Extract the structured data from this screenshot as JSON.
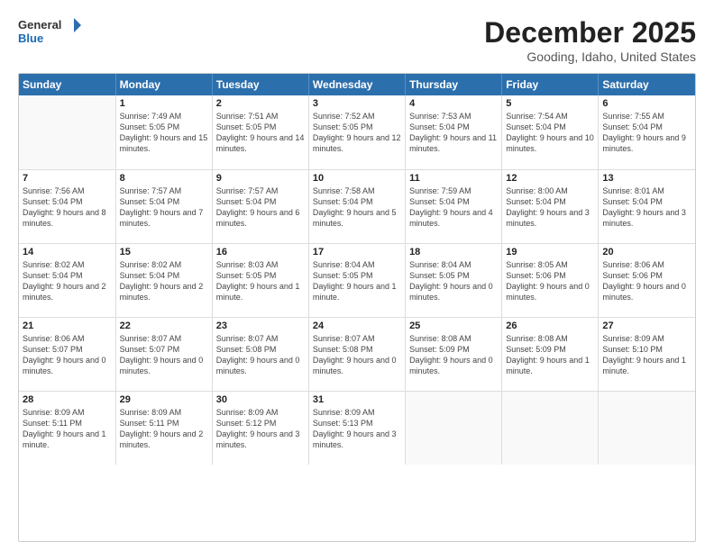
{
  "header": {
    "logo_line1": "General",
    "logo_line2": "Blue",
    "month_title": "December 2025",
    "location": "Gooding, Idaho, United States"
  },
  "days_of_week": [
    "Sunday",
    "Monday",
    "Tuesday",
    "Wednesday",
    "Thursday",
    "Friday",
    "Saturday"
  ],
  "weeks": [
    [
      {
        "day": "",
        "empty": true
      },
      {
        "day": "1",
        "sunrise": "Sunrise: 7:49 AM",
        "sunset": "Sunset: 5:05 PM",
        "daylight": "Daylight: 9 hours and 15 minutes."
      },
      {
        "day": "2",
        "sunrise": "Sunrise: 7:51 AM",
        "sunset": "Sunset: 5:05 PM",
        "daylight": "Daylight: 9 hours and 14 minutes."
      },
      {
        "day": "3",
        "sunrise": "Sunrise: 7:52 AM",
        "sunset": "Sunset: 5:05 PM",
        "daylight": "Daylight: 9 hours and 12 minutes."
      },
      {
        "day": "4",
        "sunrise": "Sunrise: 7:53 AM",
        "sunset": "Sunset: 5:04 PM",
        "daylight": "Daylight: 9 hours and 11 minutes."
      },
      {
        "day": "5",
        "sunrise": "Sunrise: 7:54 AM",
        "sunset": "Sunset: 5:04 PM",
        "daylight": "Daylight: 9 hours and 10 minutes."
      },
      {
        "day": "6",
        "sunrise": "Sunrise: 7:55 AM",
        "sunset": "Sunset: 5:04 PM",
        "daylight": "Daylight: 9 hours and 9 minutes."
      }
    ],
    [
      {
        "day": "7",
        "sunrise": "Sunrise: 7:56 AM",
        "sunset": "Sunset: 5:04 PM",
        "daylight": "Daylight: 9 hours and 8 minutes."
      },
      {
        "day": "8",
        "sunrise": "Sunrise: 7:57 AM",
        "sunset": "Sunset: 5:04 PM",
        "daylight": "Daylight: 9 hours and 7 minutes."
      },
      {
        "day": "9",
        "sunrise": "Sunrise: 7:57 AM",
        "sunset": "Sunset: 5:04 PM",
        "daylight": "Daylight: 9 hours and 6 minutes."
      },
      {
        "day": "10",
        "sunrise": "Sunrise: 7:58 AM",
        "sunset": "Sunset: 5:04 PM",
        "daylight": "Daylight: 9 hours and 5 minutes."
      },
      {
        "day": "11",
        "sunrise": "Sunrise: 7:59 AM",
        "sunset": "Sunset: 5:04 PM",
        "daylight": "Daylight: 9 hours and 4 minutes."
      },
      {
        "day": "12",
        "sunrise": "Sunrise: 8:00 AM",
        "sunset": "Sunset: 5:04 PM",
        "daylight": "Daylight: 9 hours and 3 minutes."
      },
      {
        "day": "13",
        "sunrise": "Sunrise: 8:01 AM",
        "sunset": "Sunset: 5:04 PM",
        "daylight": "Daylight: 9 hours and 3 minutes."
      }
    ],
    [
      {
        "day": "14",
        "sunrise": "Sunrise: 8:02 AM",
        "sunset": "Sunset: 5:04 PM",
        "daylight": "Daylight: 9 hours and 2 minutes."
      },
      {
        "day": "15",
        "sunrise": "Sunrise: 8:02 AM",
        "sunset": "Sunset: 5:04 PM",
        "daylight": "Daylight: 9 hours and 2 minutes."
      },
      {
        "day": "16",
        "sunrise": "Sunrise: 8:03 AM",
        "sunset": "Sunset: 5:05 PM",
        "daylight": "Daylight: 9 hours and 1 minute."
      },
      {
        "day": "17",
        "sunrise": "Sunrise: 8:04 AM",
        "sunset": "Sunset: 5:05 PM",
        "daylight": "Daylight: 9 hours and 1 minute."
      },
      {
        "day": "18",
        "sunrise": "Sunrise: 8:04 AM",
        "sunset": "Sunset: 5:05 PM",
        "daylight": "Daylight: 9 hours and 0 minutes."
      },
      {
        "day": "19",
        "sunrise": "Sunrise: 8:05 AM",
        "sunset": "Sunset: 5:06 PM",
        "daylight": "Daylight: 9 hours and 0 minutes."
      },
      {
        "day": "20",
        "sunrise": "Sunrise: 8:06 AM",
        "sunset": "Sunset: 5:06 PM",
        "daylight": "Daylight: 9 hours and 0 minutes."
      }
    ],
    [
      {
        "day": "21",
        "sunrise": "Sunrise: 8:06 AM",
        "sunset": "Sunset: 5:07 PM",
        "daylight": "Daylight: 9 hours and 0 minutes."
      },
      {
        "day": "22",
        "sunrise": "Sunrise: 8:07 AM",
        "sunset": "Sunset: 5:07 PM",
        "daylight": "Daylight: 9 hours and 0 minutes."
      },
      {
        "day": "23",
        "sunrise": "Sunrise: 8:07 AM",
        "sunset": "Sunset: 5:08 PM",
        "daylight": "Daylight: 9 hours and 0 minutes."
      },
      {
        "day": "24",
        "sunrise": "Sunrise: 8:07 AM",
        "sunset": "Sunset: 5:08 PM",
        "daylight": "Daylight: 9 hours and 0 minutes."
      },
      {
        "day": "25",
        "sunrise": "Sunrise: 8:08 AM",
        "sunset": "Sunset: 5:09 PM",
        "daylight": "Daylight: 9 hours and 0 minutes."
      },
      {
        "day": "26",
        "sunrise": "Sunrise: 8:08 AM",
        "sunset": "Sunset: 5:09 PM",
        "daylight": "Daylight: 9 hours and 1 minute."
      },
      {
        "day": "27",
        "sunrise": "Sunrise: 8:09 AM",
        "sunset": "Sunset: 5:10 PM",
        "daylight": "Daylight: 9 hours and 1 minute."
      }
    ],
    [
      {
        "day": "28",
        "sunrise": "Sunrise: 8:09 AM",
        "sunset": "Sunset: 5:11 PM",
        "daylight": "Daylight: 9 hours and 1 minute."
      },
      {
        "day": "29",
        "sunrise": "Sunrise: 8:09 AM",
        "sunset": "Sunset: 5:11 PM",
        "daylight": "Daylight: 9 hours and 2 minutes."
      },
      {
        "day": "30",
        "sunrise": "Sunrise: 8:09 AM",
        "sunset": "Sunset: 5:12 PM",
        "daylight": "Daylight: 9 hours and 3 minutes."
      },
      {
        "day": "31",
        "sunrise": "Sunrise: 8:09 AM",
        "sunset": "Sunset: 5:13 PM",
        "daylight": "Daylight: 9 hours and 3 minutes."
      },
      {
        "day": "",
        "empty": true
      },
      {
        "day": "",
        "empty": true
      },
      {
        "day": "",
        "empty": true
      }
    ]
  ]
}
